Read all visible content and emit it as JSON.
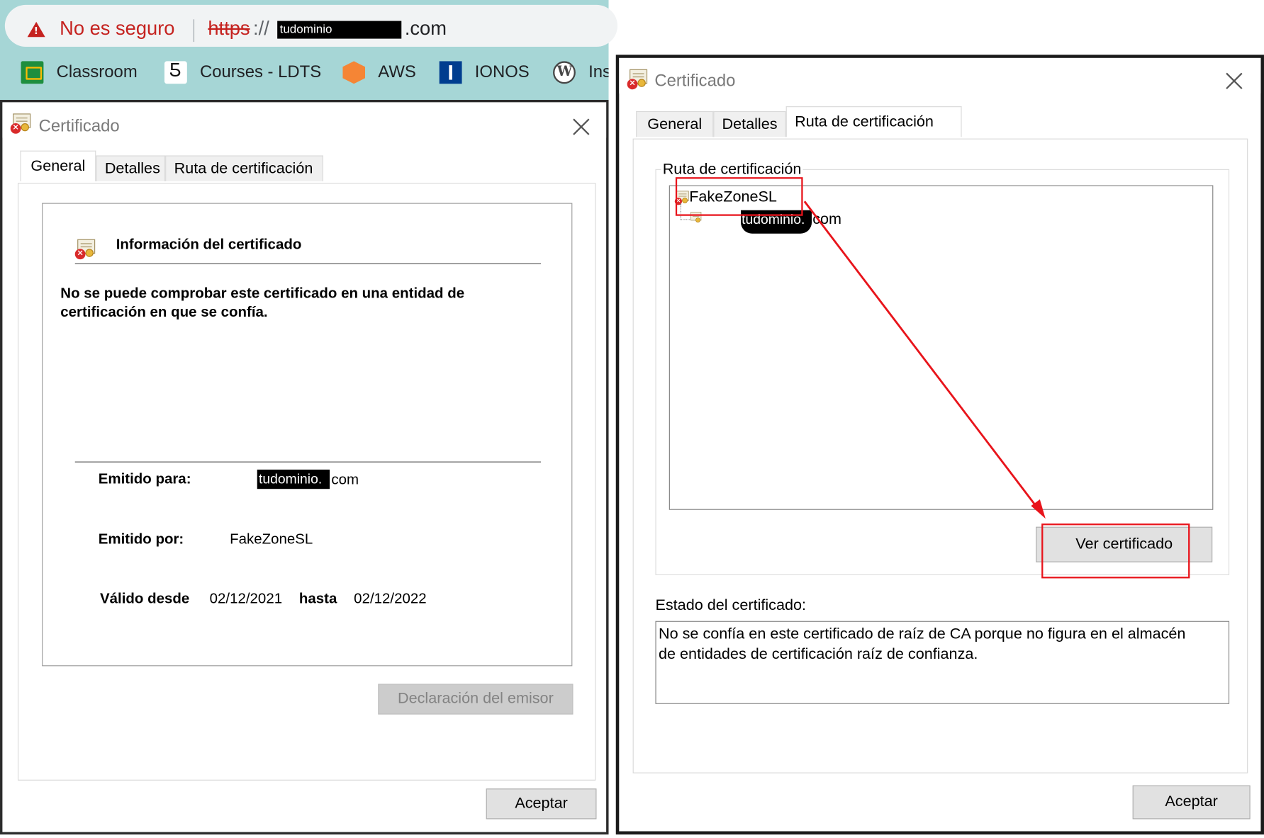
{
  "browser": {
    "security_label": "No es seguro",
    "url_scheme": "https",
    "url_slashes": "://",
    "url_domain": "tudominio",
    "url_tld": ".com",
    "bookmarks": [
      {
        "label": "Classroom",
        "icon": "classroom-icon"
      },
      {
        "label": "Courses - LDTS",
        "icon": "courses-icon"
      },
      {
        "label": "AWS",
        "icon": "aws-icon"
      },
      {
        "label": "IONOS",
        "icon": "ionos-icon"
      },
      {
        "label": "Ins",
        "icon": "wordpress-icon"
      }
    ]
  },
  "left_dialog": {
    "title": "Certificado",
    "tabs": [
      "General",
      "Detalles",
      "Ruta de certificación"
    ],
    "active_tab": "General",
    "info_heading": "Información del certificado",
    "warning_text": "No se puede comprobar este certificado en una entidad de certificación en que se confía.",
    "issued_to_label": "Emitido para:",
    "issued_to_domain": "tudominio.",
    "issued_to_tld": "com",
    "issued_by_label": "Emitido por:",
    "issued_by_value": "FakeZoneSL",
    "valid_from_label": "Válido desde",
    "valid_from_value": "02/12/2021",
    "valid_to_label": "hasta",
    "valid_to_value": "02/12/2022",
    "issuer_statement_button": "Declaración del emisor",
    "ok_button": "Aceptar"
  },
  "right_dialog": {
    "title": "Certificado",
    "tabs": [
      "General",
      "Detalles",
      "Ruta de certificación"
    ],
    "active_tab": "Ruta de certificación",
    "path_group_label": "Ruta de certificación",
    "tree": [
      {
        "label": "FakeZoneSL"
      },
      {
        "label_domain": "tudominio.",
        "label_tld": "com"
      }
    ],
    "view_cert_button": "Ver certificado",
    "status_label": "Estado del certificado:",
    "status_text": "No se confía en este certificado de raíz de CA porque no figura en el almacén de entidades de certificación raíz de confianza.",
    "ok_button": "Aceptar"
  },
  "colors": {
    "warning_red": "#c5221f",
    "annotation_red": "#e8141b",
    "bookmark_bar": "#a6d6d6"
  }
}
